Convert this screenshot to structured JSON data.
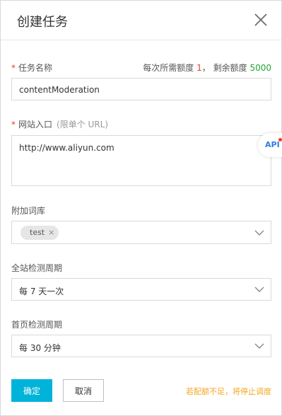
{
  "dialog": {
    "title": "创建任务",
    "close_icon": "close-icon"
  },
  "task_name": {
    "required_mark": "*",
    "label": "任务名称",
    "quota_prefix": "每次所需额度",
    "quota_cost": "1",
    "quota_sep": "，",
    "quota_remaining_label": "剩余额度",
    "quota_remaining": "5000",
    "value": "contentModeration"
  },
  "site_entry": {
    "required_mark": "*",
    "label": "网站入口",
    "hint": "(限单个 URL)",
    "value": "http://www.aliyun.com"
  },
  "api_badge": {
    "label": "API"
  },
  "dictionary": {
    "label": "附加词库",
    "tags": [
      "test"
    ],
    "tag_remove": "×",
    "chevron_icon": "chevron-down-icon"
  },
  "site_cycle": {
    "label": "全站检测周期",
    "value": "每 7 天一次",
    "chevron_icon": "chevron-down-icon"
  },
  "home_cycle": {
    "label": "首页检测周期",
    "value": "每 30 分钟",
    "chevron_icon": "chevron-down-icon"
  },
  "footer": {
    "confirm_label": "确定",
    "cancel_label": "取消",
    "warning": "若配额不足，将停止调度"
  },
  "colors": {
    "primary": "#00b3d9",
    "required": "#e5412b",
    "remaining": "#22a334",
    "warning": "#f5a623",
    "api_text": "#2f7de1"
  }
}
